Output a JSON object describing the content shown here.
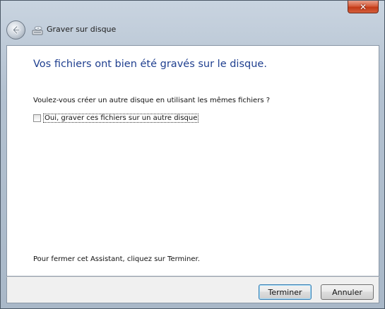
{
  "window": {
    "close_glyph": "x"
  },
  "titlebar": {
    "title": "Graver sur disque",
    "back_icon": "back-arrow-icon",
    "wizard_icon": "burn-disc-icon"
  },
  "main": {
    "heading": "Vos fichiers ont bien été gravés sur le disque.",
    "question": "Voulez-vous créer un autre disque en utilisant les mêmes fichiers ?",
    "checkbox": {
      "label": "Oui, graver ces fichiers sur un autre disque",
      "checked": false
    },
    "footer_text": "Pour fermer cet Assistant, cliquez sur Terminer."
  },
  "buttons": {
    "finish": "Terminer",
    "cancel": "Annuler"
  },
  "colors": {
    "heading": "#1f3f8f",
    "close_button": "#c23a17"
  }
}
